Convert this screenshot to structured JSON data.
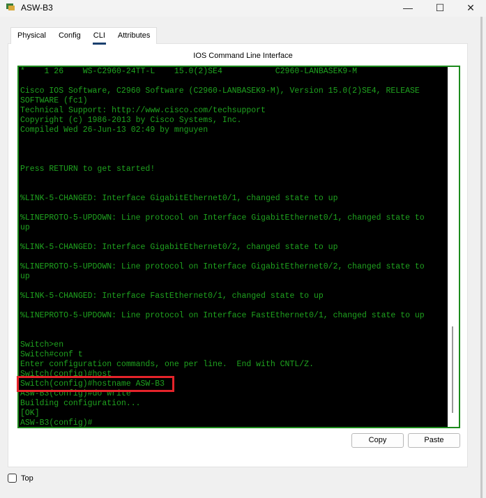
{
  "window": {
    "title": "ASW-B3",
    "minimize": "—",
    "maximize": "☐",
    "close": "✕"
  },
  "tabs": [
    {
      "label": "Physical"
    },
    {
      "label": "Config"
    },
    {
      "label": "CLI"
    },
    {
      "label": "Attributes"
    }
  ],
  "cli": {
    "heading": "IOS Command Line Interface",
    "lines": [
      "*    1 26    WS-C2960-24TT-L    15.0(2)SE4           C2960-LANBASEK9-M",
      "",
      "Cisco IOS Software, C2960 Software (C2960-LANBASEK9-M), Version 15.0(2)SE4, RELEASE",
      "SOFTWARE (fc1)",
      "Technical Support: http://www.cisco.com/techsupport",
      "Copyright (c) 1986-2013 by Cisco Systems, Inc.",
      "Compiled Wed 26-Jun-13 02:49 by mnguyen",
      "",
      "",
      "",
      "Press RETURN to get started!",
      "",
      "",
      "%LINK-5-CHANGED: Interface GigabitEthernet0/1, changed state to up",
      "",
      "%LINEPROTO-5-UPDOWN: Line protocol on Interface GigabitEthernet0/1, changed state to",
      "up",
      "",
      "%LINK-5-CHANGED: Interface GigabitEthernet0/2, changed state to up",
      "",
      "%LINEPROTO-5-UPDOWN: Line protocol on Interface GigabitEthernet0/2, changed state to",
      "up",
      "",
      "%LINK-5-CHANGED: Interface FastEthernet0/1, changed state to up",
      "",
      "%LINEPROTO-5-UPDOWN: Line protocol on Interface FastEthernet0/1, changed state to up",
      "",
      "",
      "Switch>en",
      "Switch#conf t",
      "Enter configuration commands, one per line.  End with CNTL/Z.",
      "Switch(config)#host",
      "Switch(config)#hostname ASW-B3",
      "ASW-B3(config)#do write",
      "Building configuration...",
      "[OK]",
      "ASW-B3(config)#"
    ]
  },
  "buttons": {
    "copy": "Copy",
    "paste": "Paste"
  },
  "footer": {
    "top_label": "Top",
    "top_checked": false
  },
  "colors": {
    "terminal_text": "#1fa31f",
    "terminal_bg": "#000000",
    "highlight": "#e5232a"
  }
}
